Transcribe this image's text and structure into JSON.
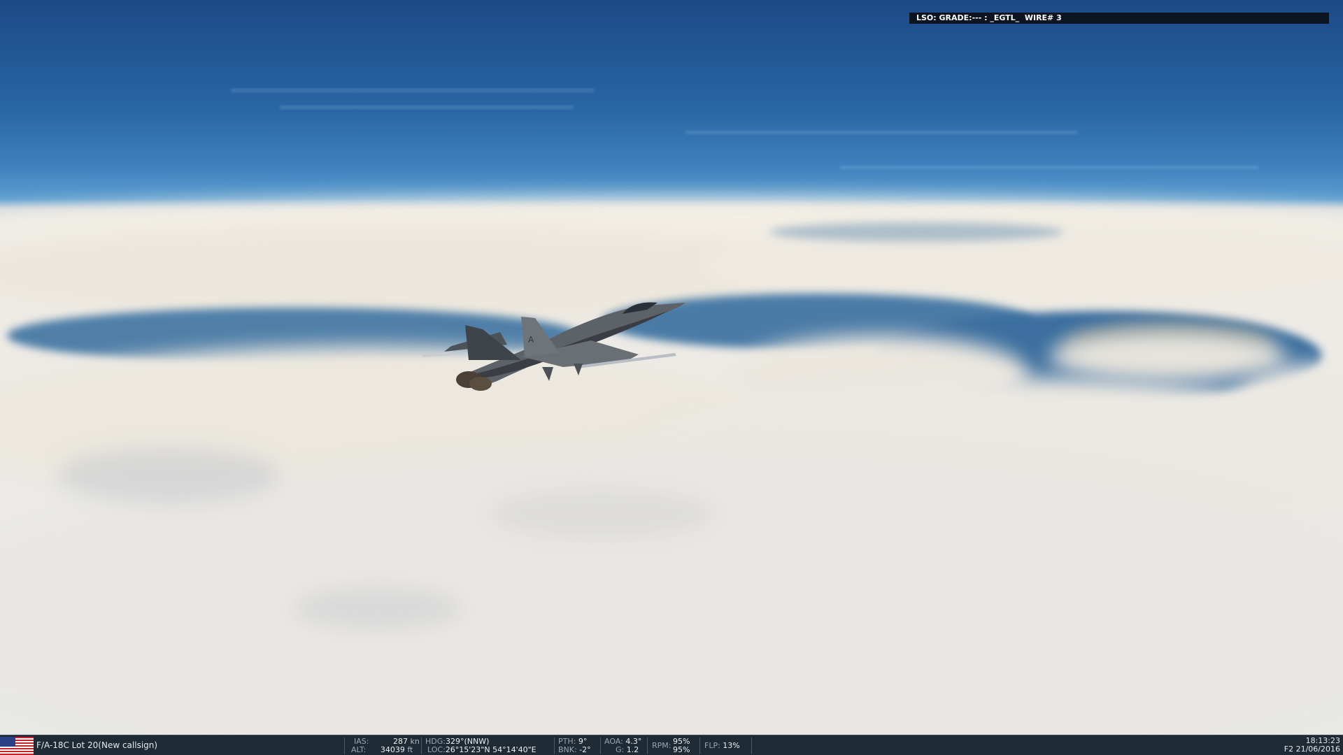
{
  "lso": {
    "text": "LSO: GRADE:--- : _EGTL_  WIRE# 3"
  },
  "status": {
    "flag_icon": "us-flag-icon",
    "aircraft": "F/A-18C Lot 20(New callsign)",
    "ias_label": "IAS:",
    "ias_value": "287",
    "ias_unit": "kn",
    "alt_label": "ALT:",
    "alt_value": "34039",
    "alt_unit": "ft",
    "hdg_label": "HDG:",
    "hdg_value": "329°(NNW)",
    "loc_label": "LOC:",
    "loc_value": "26°15'23\"N 54°14'40\"E",
    "pth_label": "PTH:",
    "pth_value": "9°",
    "bnk_label": "BNK:",
    "bnk_value": "-2°",
    "aoa_label": "AOA:",
    "aoa_value": "4.3°",
    "g_label": "G:",
    "g_value": "1.2",
    "rpm_label": "RPM:",
    "rpm_value_1": "95%",
    "rpm_value_2": "95%",
    "flp_label": "FLP:",
    "flp_value": "13%",
    "time": "18:13:23",
    "date": "F2 21/06/2016"
  },
  "colors": {
    "sky_top": "#1c4a86",
    "horizon": "#5d9ed0",
    "cloud": "#efece6",
    "statusbar": "#1e2a34"
  }
}
